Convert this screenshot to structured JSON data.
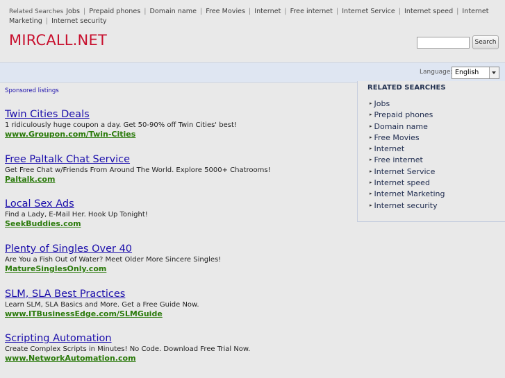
{
  "top_bar": {
    "label": "Related Searches",
    "links": [
      "Jobs",
      "Prepaid phones",
      "Domain name",
      "Free Movies",
      "Internet",
      "Free internet",
      "Internet Service",
      "Internet speed",
      "Internet Marketing",
      "Internet security"
    ]
  },
  "logo": "MIRCALL.NET",
  "search": {
    "value": "",
    "button_label": "Search"
  },
  "language": {
    "label": "Language:",
    "selected": "English"
  },
  "sponsored_label": "Sponsored listings",
  "listings": [
    {
      "title": "Twin Cities Deals",
      "description": "1 ridiculously huge coupon a day. Get 50-90% off Twin Cities' best!",
      "url": "www.Groupon.com/Twin-Cities"
    },
    {
      "title": "Free Paltalk Chat Service",
      "description": "Get Free Chat w/Friends From Around The World. Explore 5000+ Chatrooms!",
      "url": "Paltalk.com"
    },
    {
      "title": "Local Sex Ads",
      "description": "Find a Lady, E-Mail Her. Hook Up Tonight!",
      "url": "SeekBuddies.com"
    },
    {
      "title": "Plenty of Singles Over 40",
      "description": "Are You a Fish Out of Water? Meet Older More Sincere Singles!",
      "url": "MatureSinglesOnly.com"
    },
    {
      "title": "SLM, SLA Best Practices",
      "description": "Learn SLM, SLA Basics and More. Get a Free Guide Now.",
      "url": "www.ITBusinessEdge.com/SLMGuide"
    },
    {
      "title": "Scripting Automation",
      "description": "Create Complex Scripts in Minutes! No Code. Download Free Trial Now.",
      "url": "www.NetworkAutomation.com"
    }
  ],
  "related_panel": {
    "heading": "RELATED SEARCHES",
    "items": [
      "Jobs",
      "Prepaid phones",
      "Domain name",
      "Free Movies",
      "Internet",
      "Free internet",
      "Internet Service",
      "Internet speed",
      "Internet Marketing",
      "Internet security"
    ]
  },
  "colors": {
    "logo": "#c8102e",
    "link": "#1a0dab",
    "url": "#2a7a0a",
    "bar": "#dfe6f2"
  }
}
